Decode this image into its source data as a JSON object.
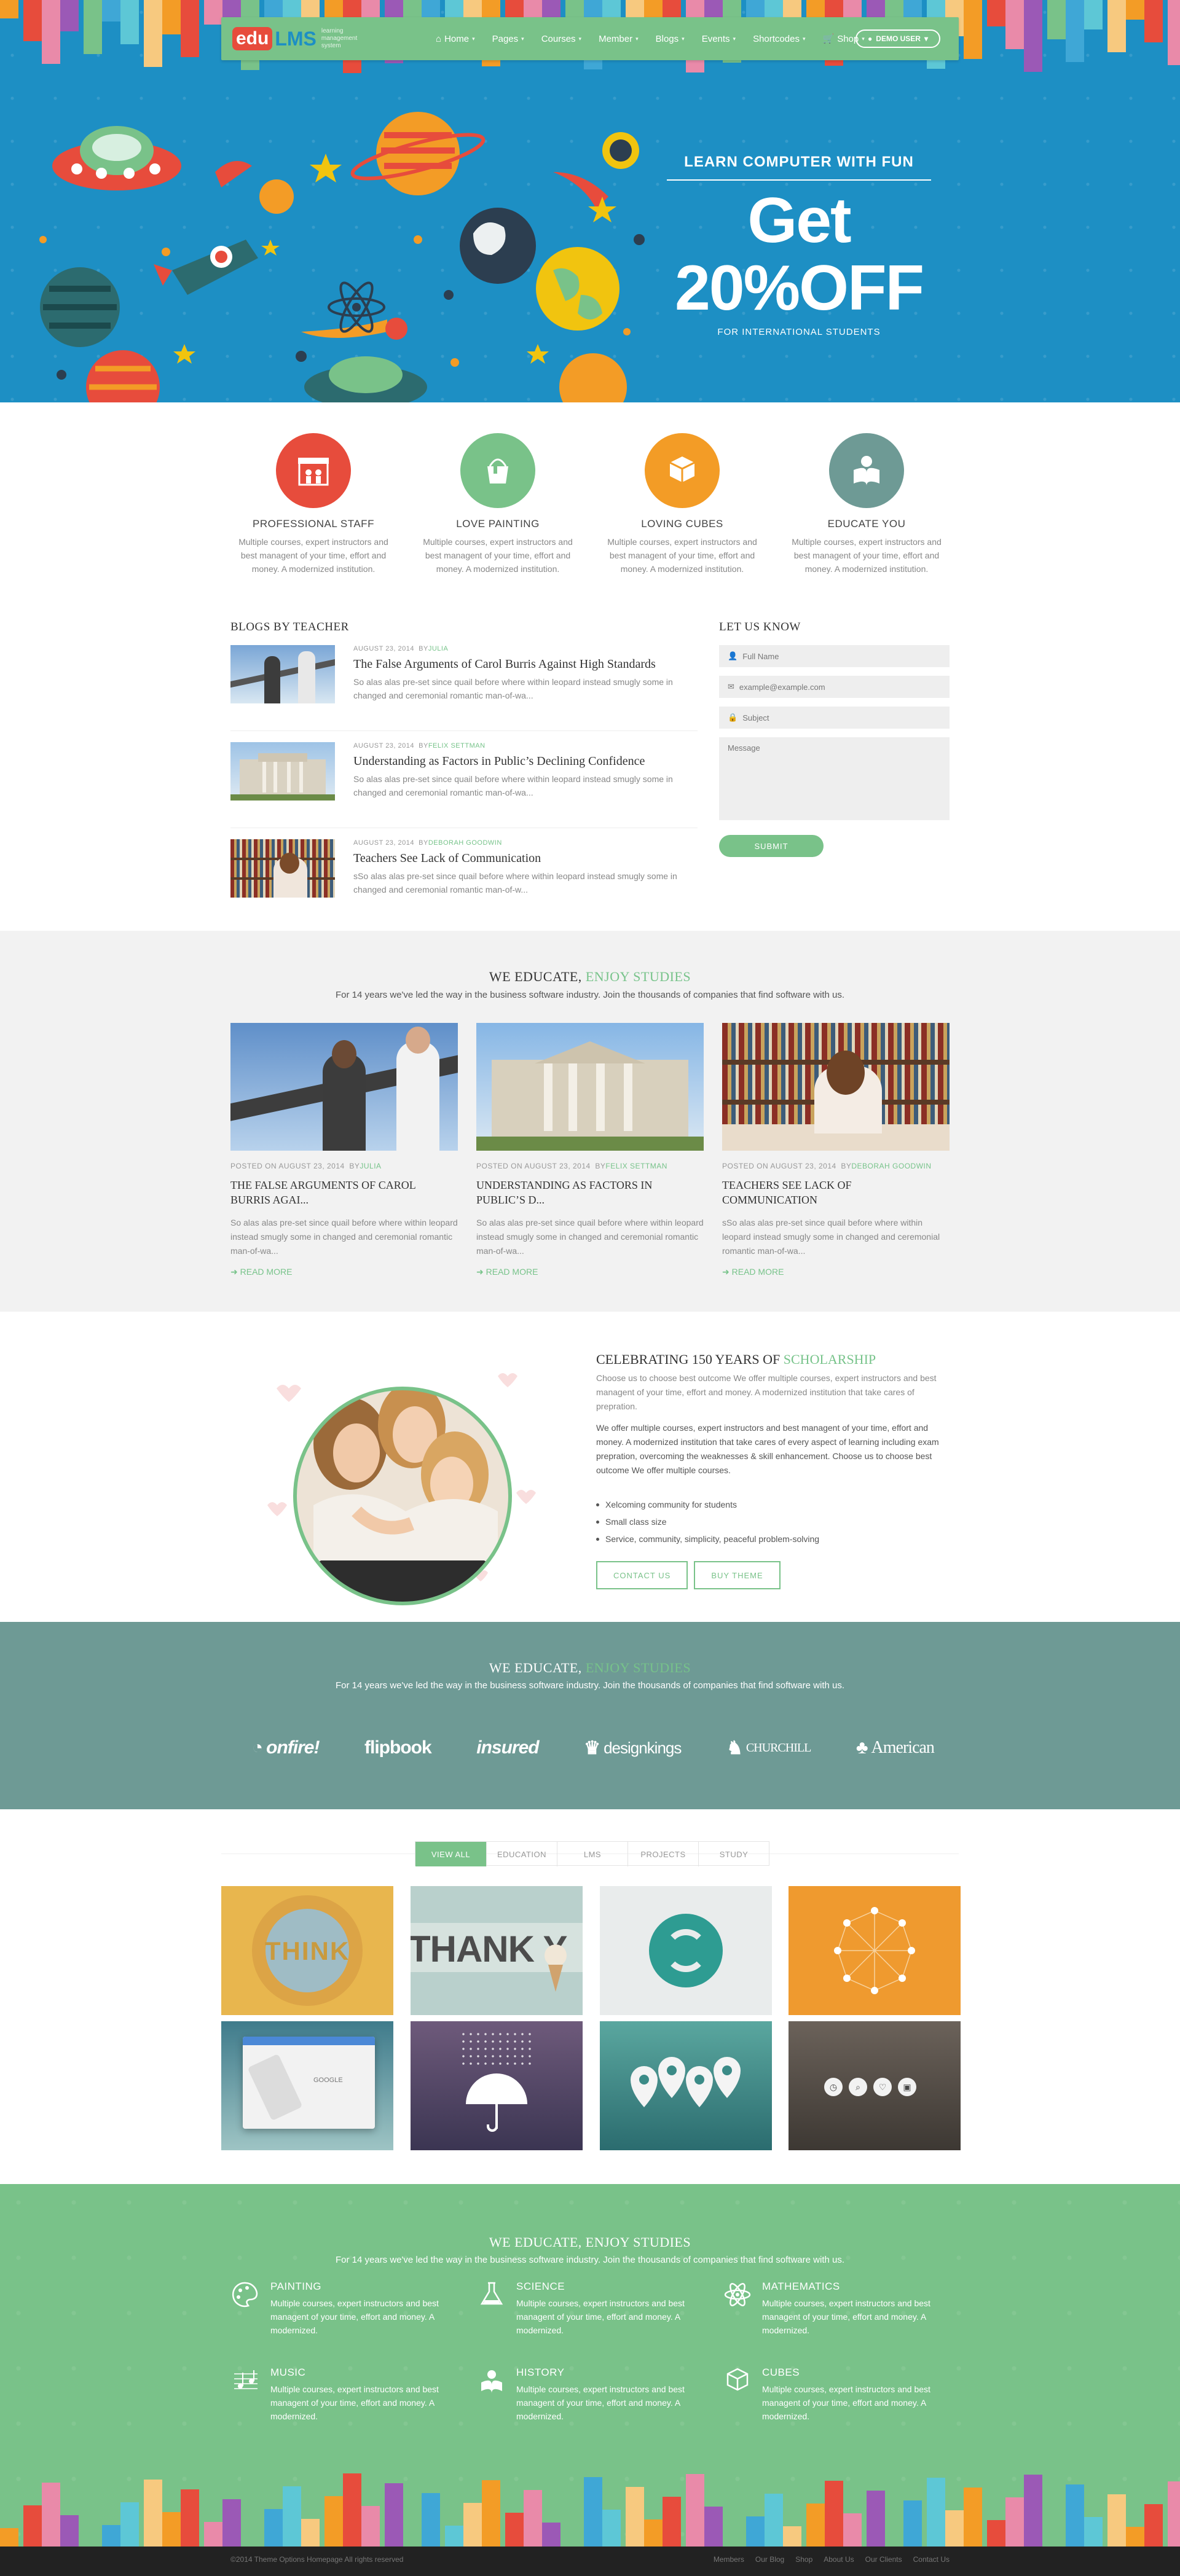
{
  "nav": {
    "logo_edu": "edu",
    "logo_lms": "LMS",
    "logo_tagline": "learning management system",
    "items": [
      {
        "label": "Home",
        "icon": "home-icon"
      },
      {
        "label": "Pages"
      },
      {
        "label": "Courses"
      },
      {
        "label": "Member"
      },
      {
        "label": "Blogs"
      },
      {
        "label": "Events"
      },
      {
        "label": "Shortcodes"
      },
      {
        "label": "Shop",
        "icon": "cart-icon"
      }
    ],
    "demo_user": "DEMO USER"
  },
  "hero": {
    "subtitle": "LEARN COMPUTER WITH FUN",
    "headline": "Get 20%OFF",
    "small": "FOR INTERNATIONAL STUDENTS"
  },
  "features": [
    {
      "title": "PROFESSIONAL STAFF",
      "text": "Multiple courses, expert instructors and best managent of your time, effort and money. A modernized institution.",
      "color": "#e74c3c",
      "icon": "school-icon"
    },
    {
      "title": "LOVE PAINTING",
      "text": "Multiple courses, expert instructors and best managent of your time, effort and money. A modernized institution.",
      "color": "#79c289",
      "icon": "paint-bucket-icon"
    },
    {
      "title": "LOVING CUBES",
      "text": "Multiple courses, expert instructors and best managent of your time, effort and money. A modernized institution.",
      "color": "#f39c26",
      "icon": "cubes-icon"
    },
    {
      "title": "EDUCATE YOU",
      "text": "Multiple courses, expert instructors and best managent of your time, effort and money. A modernized institution.",
      "color": "#6e9a95",
      "icon": "book-reader-icon"
    }
  ],
  "blogs": {
    "title": "BLOGS BY TEACHER",
    "items": [
      {
        "date": "AUGUST 23, 2014",
        "by": "BY",
        "author": "JULIA",
        "title": "The False Arguments of Carol Burris Against High Standards",
        "excerpt": "So alas alas pre-set since quail before where within leopard instead smugly some in changed and ceremonial romantic man-of-wa..."
      },
      {
        "date": "AUGUST 23, 2014",
        "by": "BY",
        "author": "FELIX SETTMAN",
        "title": "Understanding as Factors in Public’s Declining Confidence",
        "excerpt": "So alas alas pre-set since quail before where within leopard instead smugly some in changed and ceremonial romantic man-of-wa..."
      },
      {
        "date": "AUGUST 23, 2014",
        "by": "BY",
        "author": "DEBORAH GOODWIN",
        "title": "Teachers See Lack of Communication",
        "excerpt": "sSo alas alas pre-set since quail before where within leopard instead smugly some in changed and ceremonial romantic man-of-w..."
      }
    ]
  },
  "contact": {
    "title": "LET US KNOW",
    "name_placeholder": "Full Name",
    "email_placeholder": "example@example.com",
    "subject_placeholder": "Subject",
    "message_placeholder": "Message",
    "submit": "SUBMIT"
  },
  "educate": {
    "title_a": "WE EDUCATE,",
    "title_b": "ENJOY STUDIES",
    "subtitle": "For 14 years we've led the way in the business software industry. Join the thousands of companies that find software with us.",
    "cards": [
      {
        "posted": "POSTED ON AUGUST 23, 2014",
        "by": "BY",
        "author": "JULIA",
        "title": "THE FALSE ARGUMENTS OF CAROL BURRIS AGAI...",
        "excerpt": "So alas alas pre-set since quail before where within leopard instead smugly some in changed and ceremonial romantic man-of-wa...",
        "read": "READ MORE"
      },
      {
        "posted": "POSTED ON AUGUST 23, 2014",
        "by": "BY",
        "author": "FELIX SETTMAN",
        "title": "UNDERSTANDING AS FACTORS IN PUBLIC’S D...",
        "excerpt": "So alas alas pre-set since quail before where within leopard instead smugly some in changed and ceremonial romantic man-of-wa...",
        "read": "READ MORE"
      },
      {
        "posted": "POSTED ON AUGUST 23, 2014",
        "by": "BY",
        "author": "DEBORAH GOODWIN",
        "title": "TEACHERS SEE LACK OF COMMUNICATION",
        "excerpt": "sSo alas alas pre-set since quail before where within leopard instead smugly some in changed and ceremonial romantic man-of-wa...",
        "read": "READ MORE"
      }
    ]
  },
  "celebrate": {
    "title_a": "CELEBRATING 150 YEARS OF",
    "title_b": "SCHOLARSHIP",
    "intro": "Choose us to choose best outcome We offer multiple courses, expert instructors and best managent of your time, effort and money. A modernized institution that take cares of prepration.",
    "body": "We offer multiple courses, expert instructors and best managent of your time, effort and money. A modernized institution that take cares of every aspect of learning including exam prepration, overcoming the weaknesses & skill enhancement. Choose us to choose best outcome We offer multiple courses.",
    "bullets": [
      "Xelcoming community for students",
      "Small class size",
      "Service, community, simplicity, peaceful problem-solving"
    ],
    "btn_contact": "CONTACT US",
    "btn_buy": "BUY THEME"
  },
  "partners": {
    "title_a": "WE EDUCATE,",
    "title_b": "ENJOY STUDIES",
    "subtitle": "For 14 years we've led the way in the business software industry. Join the thousands of companies that find software with us.",
    "logos": [
      "onfire!",
      "flipbook",
      "insured",
      "designkings",
      "CHURCHILL",
      "American"
    ]
  },
  "portfolio": {
    "filters": [
      "VIEW ALL",
      "EDUCATION",
      "LMS",
      "PROJECTS",
      "STUDY"
    ],
    "tile_texts": {
      "think": "THINK",
      "thanks": "THANK Y",
      "google": "GOOGLE"
    }
  },
  "subjects": {
    "title": "WE EDUCATE, ENJOY STUDIES",
    "subtitle": "For 14 years we've led the way in the business software industry. Join the thousands of companies that find software with us.",
    "items": [
      {
        "title": "PAINTING",
        "text": "Multiple courses, expert instructors and best managent of your time, effort and money. A modernized.",
        "icon": "palette-icon"
      },
      {
        "title": "SCIENCE",
        "text": "Multiple courses, expert instructors and best managent of your time, effort and money. A modernized.",
        "icon": "flask-icon"
      },
      {
        "title": "MATHEMATICS",
        "text": "Multiple courses, expert instructors and best managent of your time, effort and money. A modernized.",
        "icon": "atom-icon"
      },
      {
        "title": "MUSIC",
        "text": "Multiple courses, expert instructors and best managent of your time, effort and money. A modernized.",
        "icon": "music-icon"
      },
      {
        "title": "HISTORY",
        "text": "Multiple courses, expert instructors and best managent of your time, effort and money. A modernized.",
        "icon": "history-icon"
      },
      {
        "title": "CUBES",
        "text": "Multiple courses, expert instructors and best managent of your time, effort and money. A modernized.",
        "icon": "cube-icon"
      }
    ]
  },
  "footer": {
    "copyright": "©2014 Theme Options Homepage All rights reserved",
    "links": [
      "Members",
      "Our Blog",
      "Shop",
      "About Us",
      "Our Clients",
      "Contact Us"
    ]
  },
  "colors": {
    "green": "#79c289",
    "blue": "#1d8fc4",
    "teal": "#6e9a95",
    "red": "#e74c3c",
    "orange": "#f39c26"
  }
}
